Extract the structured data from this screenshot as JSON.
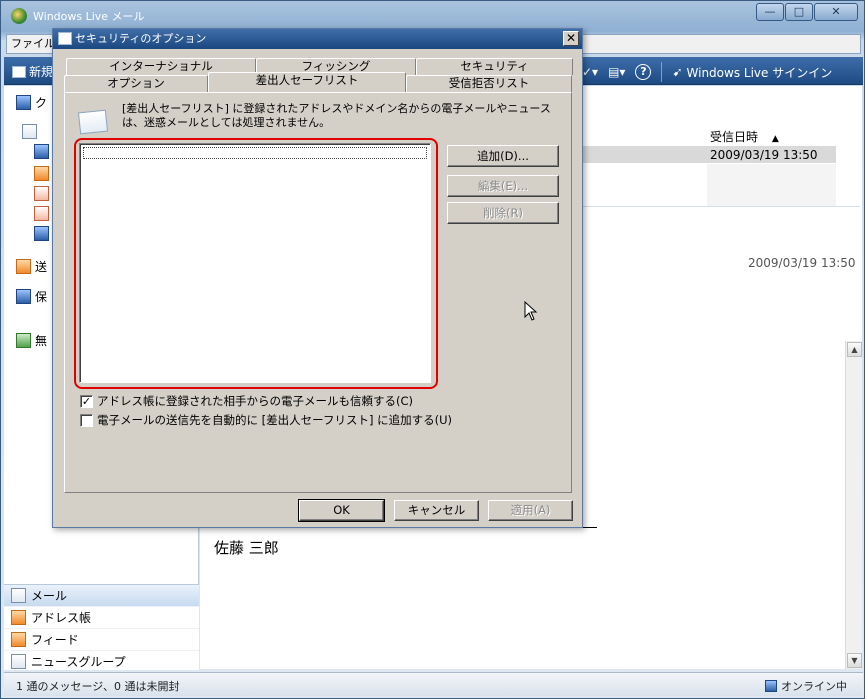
{
  "app": {
    "title": "Windows Live メール",
    "menu_label": "ファイル(",
    "caption_buttons": [
      "—",
      "□",
      "✕"
    ]
  },
  "toolbar": {
    "new_label": "新規",
    "help_glyph": "?",
    "signin_label": "Windows Live サインイン"
  },
  "left_pane": {
    "quick_label": "ク",
    "sent_label": "送",
    "save_label": "保",
    "unread_label": "無"
  },
  "bottom_nav": [
    {
      "label": "メール"
    },
    {
      "label": "アドレス帳"
    },
    {
      "label": "フィード"
    },
    {
      "label": "ニュースグループ"
    }
  ],
  "message_list": {
    "date_header": "受信日時",
    "sort_glyph": "▲",
    "selected_date": "2009/03/19 13:50",
    "preview_date": "2009/03/19 13:50",
    "preview_name": "佐藤 三郎"
  },
  "statusbar": {
    "left_text": "1 通のメッセージ、0 通は未開封",
    "right_text": "オンライン中"
  },
  "dialog": {
    "title": "セキュリティのオプション",
    "close_glyph": "✕",
    "tabs_row1": [
      "インターナショナル",
      "フィッシング",
      "セキュリティ"
    ],
    "tabs_row2": [
      "オプション",
      "差出人セーフリスト",
      "受信拒否リスト"
    ],
    "active_tab": "差出人セーフリスト",
    "description": "[差出人セーフリスト] に登録されたアドレスやドメイン名からの電子メールやニュースは、迷惑メールとしては処理されません。",
    "buttons": {
      "add": "追加(D)...",
      "edit": "編集(E)...",
      "delete": "削除(R)"
    },
    "checkbox_trust": {
      "label": "アドレス帳に登録された相手からの電子メールも信頼する(C)",
      "checked": true
    },
    "checkbox_auto_add": {
      "label": "電子メールの送信先を自動的に [差出人セーフリスト] に追加する(U)",
      "checked": false
    },
    "footer": {
      "ok": "OK",
      "cancel": "キャンセル",
      "apply": "適用(A)"
    }
  }
}
